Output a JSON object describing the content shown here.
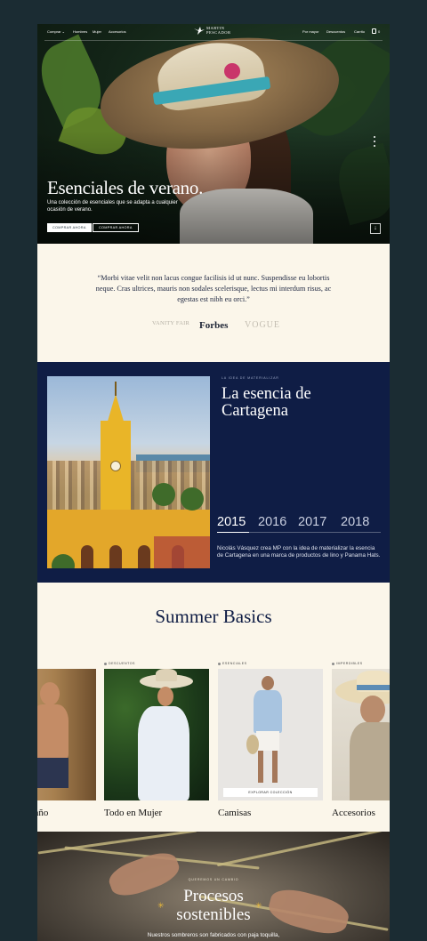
{
  "nav": {
    "left_items": [
      "Comprar ⌄",
      "Hombres",
      "Mujer",
      "Accesorios"
    ],
    "right_items": [
      "Por mayor",
      "Descuentos",
      "Carrito"
    ],
    "cart_count": "0",
    "logo_line1": "MARTIN",
    "logo_line2": "PESCADOR"
  },
  "hero": {
    "title": "Esenciales de verano.",
    "subtitle": "Una colección de esenciales que se adapta a cualquier ocasión de verano.",
    "btn_primary": "Comprar ahora",
    "btn_secondary": "Comprar ahora"
  },
  "quote": {
    "text": "“Morbi vitae velit non lacus congue facilisis id ut nunc. Suspendisse eu lobortis neque. Cras ultrices, mauris non sodales scelerisque, lectus mi interdum risus, ac egestas est nibh eu orci.”",
    "press": [
      "VANITY FAIR",
      "Forbes",
      "VOGUE"
    ]
  },
  "cartagena": {
    "eyebrow": "La idea de materializar",
    "title": "La esencia de Cartagena",
    "years": [
      "2015",
      "2016",
      "2017",
      "2018"
    ],
    "active_year": "2015",
    "description": "Nicolás Vásquez crea MP con la idea de materializar la esencia de Cartagena en una marca de productos de lino y Panama Hats."
  },
  "basics": {
    "title": "Summer Basics",
    "cards": [
      {
        "tag": "",
        "label": "Trajes de baño"
      },
      {
        "tag": "Descuentos",
        "label": "Todo en Mujer"
      },
      {
        "tag": "Esenciales",
        "label": "Camisas",
        "cta": "Explorar colección"
      },
      {
        "tag": "Imperdibles",
        "label": "Accesorios"
      }
    ]
  },
  "procesos": {
    "eyebrow": "Queremos un cambio",
    "title_line1": "Procesos",
    "title_line2": "sostenibles",
    "description": "Nuestros sombreros son fabricados con paja toquilla,"
  },
  "colors": {
    "page_bg": "#1b2c33",
    "cream": "#fbf6ea",
    "navy": "#0f1d45",
    "accent_gold": "#e9b93a"
  }
}
